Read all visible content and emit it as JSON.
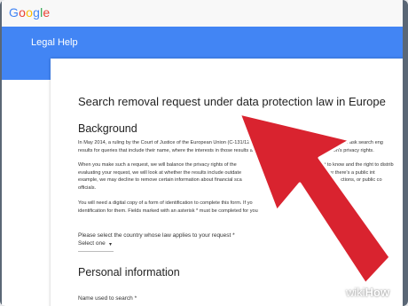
{
  "header": {
    "logo_text": "Google",
    "logo_colors": [
      "#4285f4",
      "#ea4335",
      "#fbbc05",
      "#4285f4",
      "#34a853",
      "#ea4335"
    ]
  },
  "banner": {
    "title": "Legal Help",
    "color": "#4285f4"
  },
  "form": {
    "title": "Search removal request under data protection law in Europe",
    "background_heading": "Background",
    "para1": [
      "In May 2014, a ruling by the Court of Justice of the European Union (C-131/12, 13 May 2014) found that certain people can ask search eng",
      "results for queries that include their name, where the interests in those results appearing are outweighed by the person's privacy rights."
    ],
    "para2": [
      "When you make such a request, we will balance the privacy rights of the",
      "lic's interest to know and the right to distrib",
      "evaluating your request, we will look at whether the results include outdate",
      "e look at whether there's a public int",
      "example, we may decline to remove certain information about financial sca",
      "ctions, or public co",
      "officials."
    ],
    "para3": [
      "You will need a digital copy of a form of identification to complete this form. If yo",
      "identification for them. Fields marked with an asterisk * must be completed for you"
    ],
    "country_label": "Please select the country whose law applies to your request *",
    "country_select": "Select one",
    "personal_heading": "Personal information",
    "name_label": "Name used to search *"
  },
  "overlay": {
    "arrow_color": "#d9232f",
    "watermark_wiki": "wiki",
    "watermark_how": "How"
  }
}
